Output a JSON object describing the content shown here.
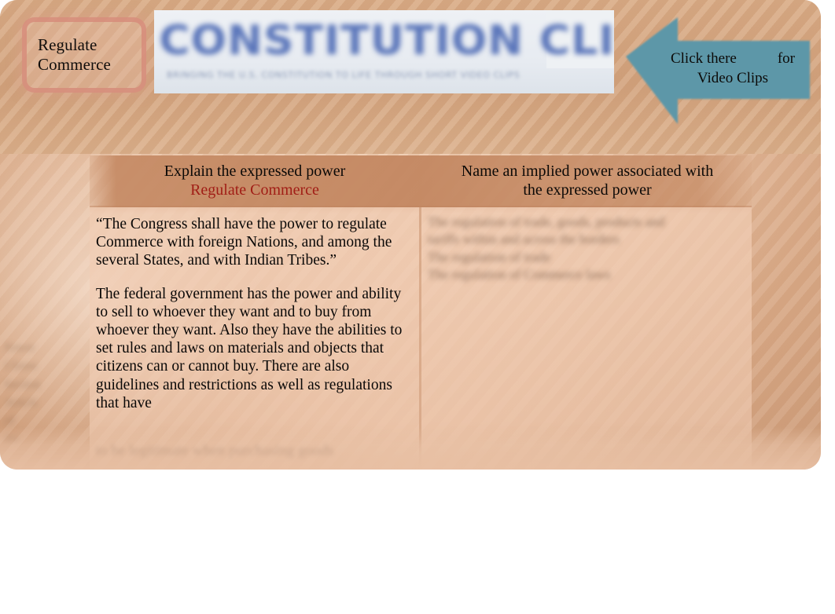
{
  "slide": {
    "topic_badge": {
      "line1": "Regulate",
      "line2": "Commerce"
    },
    "logo": {
      "wordmark": "CONSTITUTION CLIPS",
      "tagline": "BRINGING THE U.S. CONSTITUTION TO LIFE THROUGH SHORT VIDEO CLIPS"
    },
    "callout": {
      "text_before_gap": "Click there",
      "text_after_gap": "for",
      "text_line2": "Video Clips",
      "arrow_direction": "left",
      "arrow_color": "#5d97a8"
    }
  },
  "table": {
    "headers": {
      "left_line1": "Explain the expressed power",
      "left_line2_highlight": "Regulate Commerce",
      "right_line1": "Name an implied power associated with",
      "right_line2": "the expressed power"
    },
    "left_cell": {
      "paragraph_1": "“The Congress shall have the power to regulate Commerce with foreign Nations, and among the several States, and with Indian Tribes.”",
      "paragraph_2": "The federal government has the power and ability to sell to whoever they want and to buy from whoever they want. Also they have the abilities to set rules and laws on materials and objects that citizens can or cannot buy. There are also guidelines and restrictions as well as regulations that have",
      "clipped_line": "to be legitimate when purchasing goods"
    },
    "right_cell": {
      "obscured_lines": [
        "The regulation of trade, goods, products and",
        "tariffs within and across the borders",
        "The regulation of trade",
        "The regulation of Commerce laws"
      ]
    },
    "left_margin_notes": [
      "Power",
      "Clause",
      "Section",
      "Article",
      "of",
      "the"
    ]
  },
  "colors": {
    "card_background": "#e9c2a5",
    "header_band": "#c58a64",
    "body_cell": "#f1cdb4",
    "highlight_red": "#a11e16",
    "logo_blue": "#5b76ba",
    "arrow_teal": "#5d97a8",
    "badge_border": "#d68c7a"
  }
}
